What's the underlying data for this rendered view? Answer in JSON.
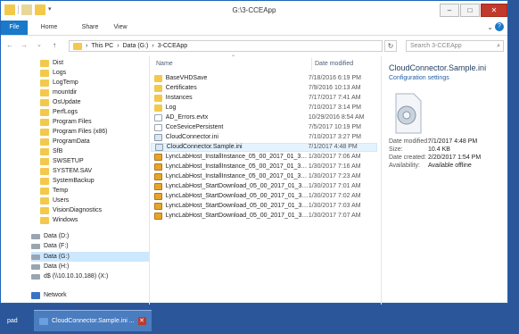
{
  "window": {
    "title": "G:\\3-CCEApp"
  },
  "ribbon": {
    "tabs": [
      "File",
      "Home",
      "Share",
      "View"
    ]
  },
  "address": {
    "segments": [
      "This PC",
      "Data (G:)",
      "3-CCEApp"
    ],
    "search_placeholder": "Search 3-CCEApp"
  },
  "nav": {
    "items": [
      {
        "label": "Dist",
        "type": "folder"
      },
      {
        "label": "Logs",
        "type": "folder"
      },
      {
        "label": "LogTemp",
        "type": "folder"
      },
      {
        "label": "mountdir",
        "type": "folder"
      },
      {
        "label": "OsUpdate",
        "type": "folder"
      },
      {
        "label": "PerfLogs",
        "type": "folder"
      },
      {
        "label": "Program Files",
        "type": "folder"
      },
      {
        "label": "Program Files (x86)",
        "type": "folder"
      },
      {
        "label": "ProgramData",
        "type": "folder"
      },
      {
        "label": "SfB",
        "type": "folder"
      },
      {
        "label": "SWSETUP",
        "type": "folder"
      },
      {
        "label": "SYSTEM.SAV",
        "type": "folder"
      },
      {
        "label": "SystemBackup",
        "type": "folder"
      },
      {
        "label": "Temp",
        "type": "folder"
      },
      {
        "label": "Users",
        "type": "folder"
      },
      {
        "label": "VisionDiagnostics",
        "type": "folder"
      },
      {
        "label": "Windows",
        "type": "folder"
      },
      {
        "label": "Data (D:)",
        "type": "drive"
      },
      {
        "label": "Data (F:)",
        "type": "drive"
      },
      {
        "label": "Data (G:)",
        "type": "drive",
        "selected": true
      },
      {
        "label": "Data (H:)",
        "type": "drive"
      },
      {
        "label": "d$ (\\\\10.10.10.188) (X:)",
        "type": "drive"
      },
      {
        "label": "Network",
        "type": "network"
      }
    ]
  },
  "files": {
    "columns": {
      "name": "Name",
      "date": "Date modified"
    },
    "rows": [
      {
        "name": "BaseVHDSave",
        "date": "7/18/2016 6:19 PM",
        "type": "folder"
      },
      {
        "name": "Certificates",
        "date": "7/9/2016 10:13 AM",
        "type": "folder"
      },
      {
        "name": "Instances",
        "date": "7/17/2017 7:41 AM",
        "type": "folder"
      },
      {
        "name": "Log",
        "date": "7/10/2017 3:14 PM",
        "type": "folder"
      },
      {
        "name": "AD_Errors.evtx",
        "date": "10/29/2016 8:54 AM",
        "type": "file"
      },
      {
        "name": "CceSevicePersistent",
        "date": "7/5/2017 10:19 PM",
        "type": "file"
      },
      {
        "name": "CloudConnector.ini",
        "date": "7/10/2017 3:27 PM",
        "type": "cfg"
      },
      {
        "name": "CloudConnector.Sample.ini",
        "date": "7/1/2017 4:48 PM",
        "type": "cfg",
        "selected": true
      },
      {
        "name": "LyncLabHost_InstallInstance_05_00_2017_01_30_07_06...",
        "date": "1/30/2017 7:06 AM",
        "type": "app"
      },
      {
        "name": "LyncLabHost_InstallInstance_05_00_2017_01_30_07_07...",
        "date": "1/30/2017 7:16 AM",
        "type": "app"
      },
      {
        "name": "LyncLabHost_InstallInstance_05_00_2017_01_30_07_07...",
        "date": "1/30/2017 7:23 AM",
        "type": "app"
      },
      {
        "name": "LyncLabHost_StartDownload_05_00_2017_01_30_07_01...",
        "date": "1/30/2017 7:01 AM",
        "type": "app"
      },
      {
        "name": "LyncLabHost_StartDownload_05_00_2017_01_30_07_02...",
        "date": "1/30/2017 7:02 AM",
        "type": "app"
      },
      {
        "name": "LyncLabHost_StartDownload_05_00_2017_01_30_07_03...",
        "date": "1/30/2017 7:03 AM",
        "type": "app"
      },
      {
        "name": "LyncLabHost_StartDownload_05_00_2017_01_30_07_0...",
        "date": "1/30/2017 7:07 AM",
        "type": "app"
      }
    ]
  },
  "preview": {
    "title": "CloudConnector.Sample.ini",
    "type": "Configuration settings",
    "details": [
      {
        "k": "Date modified:",
        "v": "7/1/2017 4:48 PM"
      },
      {
        "k": "Size:",
        "v": "10.4 KB"
      },
      {
        "k": "Date created:",
        "v": "2/20/2017 1:54 PM"
      },
      {
        "k": "Availability:",
        "v": "Available offline"
      }
    ]
  },
  "taskbar": {
    "left_label": "pad",
    "active_label": "CloudConnector.Sample.ini ..."
  }
}
